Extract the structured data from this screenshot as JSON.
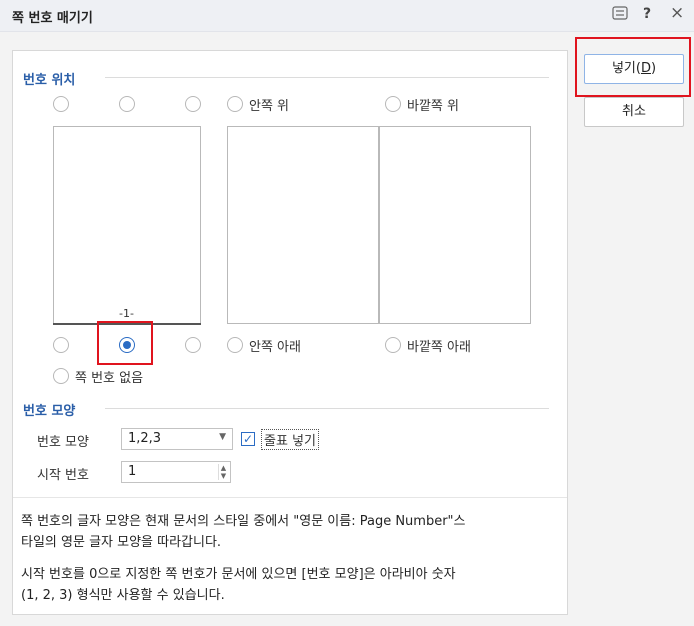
{
  "window": {
    "title": "쪽 번호 매기기",
    "icons": [
      "keyboard-icon",
      "help-icon",
      "close-icon"
    ],
    "help_glyph": "?",
    "close_glyph": "×",
    "menu_glyph": "☰"
  },
  "position": {
    "section_title": "번호 위치",
    "inner_top_label": "안쪽 위",
    "outer_top_label": "바깥쪽 위",
    "inner_bottom_label": "안쪽 아래",
    "outer_bottom_label": "바깥쪽 아래",
    "no_number_label": "쪽 번호 없음",
    "preview_page_number": "-1-",
    "selected": "bottom-center"
  },
  "format": {
    "section_title": "번호 모양",
    "shape_label": "번호 모양",
    "shape_value": "1,2,3",
    "include_dash_label": "줄표 넣기",
    "include_dash_checked": true,
    "start_label": "시작 번호",
    "start_value": "1"
  },
  "notes": {
    "line1": "쪽 번호의 글자 모양은 현재 문서의 스타일 중에서 \"영문 이름: Page Number\"스",
    "line2": "타일의 영문 글자 모양을 따라갑니다.",
    "line3": "시작 번호를 0으로 지정한 쪽 번호가 문서에 있으면 [번호 모양]은 아라비아 숫자",
    "line4": "(1, 2, 3) 형식만 사용할 수 있습니다."
  },
  "buttons": {
    "insert_label": "넣기",
    "insert_accesskey": "D",
    "cancel_label": "취소"
  },
  "colors": {
    "accent": "#2b6cc4",
    "section_title": "#2a5ea8",
    "highlight_box": "#e0141e"
  }
}
